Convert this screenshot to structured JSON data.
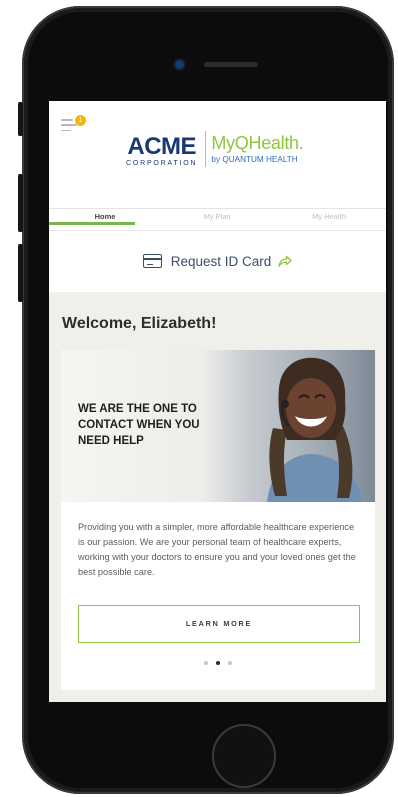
{
  "header": {
    "notification_count": "1",
    "logo": {
      "acme_word": "ACME",
      "acme_sub": "CORPORATION",
      "myq_word": "MyQHealth.",
      "myq_sub": "by QUANTUM HEALTH"
    }
  },
  "tabs": [
    {
      "label": "Home",
      "active": true
    },
    {
      "label": "My Plan",
      "active": false
    },
    {
      "label": "My Health",
      "active": false
    }
  ],
  "request_id": {
    "label": "Request ID Card"
  },
  "welcome": {
    "title": "Welcome, Elizabeth!",
    "hero_text": "WE ARE THE ONE TO CONTACT WHEN YOU NEED HELP",
    "body": "Providing you with a simpler, more affordable healthcare experience is our passion. We are your personal team of healthcare experts, working with your doctors to ensure you and your loved ones get the best possible care.",
    "button_label": "LEARN MORE",
    "carousel": {
      "count": 3,
      "active_index": 1
    }
  },
  "colors": {
    "accent_green": "#8dc63f",
    "acme_blue": "#173a72",
    "quantum_blue": "#2e6fb4",
    "badge_yellow": "#f3b80b",
    "section_bg": "#f0efe9"
  },
  "icons": {
    "menu": "hamburger-menu-icon",
    "card": "id-card-icon",
    "share": "share-arrow-icon"
  }
}
